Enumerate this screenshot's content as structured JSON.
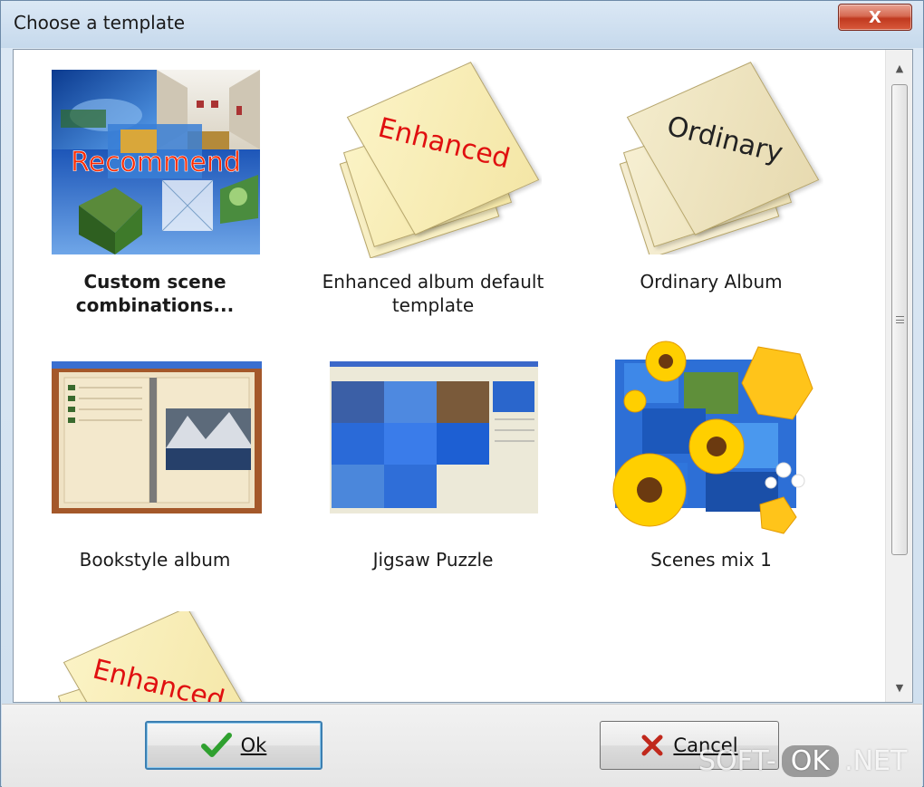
{
  "window": {
    "title": "Choose a template"
  },
  "close_button": {
    "label": "X"
  },
  "templates": [
    {
      "label": "Custom scene combinations...",
      "thumb_text": "Recommend",
      "selected": true
    },
    {
      "label": "Enhanced album default template",
      "thumb_text": "Enhanced"
    },
    {
      "label": "Ordinary Album",
      "thumb_text": "Ordinary"
    },
    {
      "label": "Bookstyle album"
    },
    {
      "label": "Jigsaw Puzzle"
    },
    {
      "label": "Scenes mix 1"
    },
    {
      "label": "",
      "thumb_text": "Enhanced"
    }
  ],
  "buttons": {
    "ok_label": "Ok",
    "ok_icon": "checkmark-icon",
    "cancel_label": "Cancel",
    "cancel_icon": "x-icon"
  },
  "watermark": {
    "left": "SOFT-",
    "badge": "OK",
    "right": ".NET"
  },
  "colors": {
    "recommend_text": "#ff2a00",
    "enhanced_text": "#e01010",
    "ordinary_text": "#222222",
    "ok_check": "#2fa02f",
    "cancel_x": "#c0281c"
  }
}
